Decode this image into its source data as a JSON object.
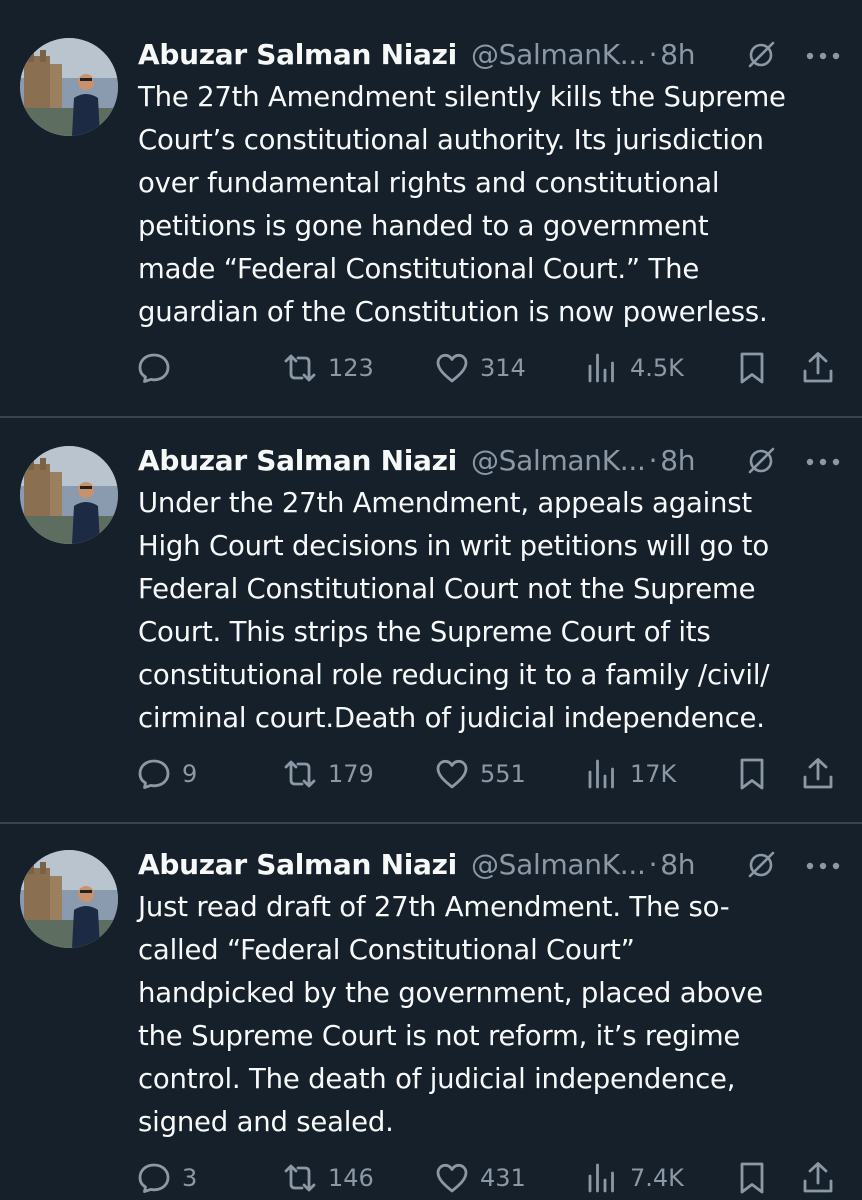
{
  "tweets": [
    {
      "author": {
        "name": "Abuzar Salman Niazi",
        "handle": "@SalmanK...",
        "separator": "·",
        "time": "8h"
      },
      "text": "The 27th Amendment silently kills the Supreme\nCourt’s constitutional authority. Its jurisdiction\nover fundamental rights and constitutional\npetitions is gone  handed to a government\nmade “Federal Constitutional Court.” The\nguardian of the Constitution is now powerless.",
      "stats": {
        "replies": "",
        "retweets": "123",
        "likes": "314",
        "views": "4.5K"
      }
    },
    {
      "author": {
        "name": "Abuzar Salman Niazi",
        "handle": "@SalmanK...",
        "separator": "·",
        "time": "8h"
      },
      "text": "Under the 27th Amendment, appeals against\nHigh Court decisions in writ petitions will go to\nFederal Constitutional Court not the Supreme\nCourt. This strips the Supreme Court of its\nconstitutional role  reducing it to a family /civil/\ncirminal court.Death of judicial independence.",
      "stats": {
        "replies": "9",
        "retweets": "179",
        "likes": "551",
        "views": "17K"
      }
    },
    {
      "author": {
        "name": "Abuzar Salman Niazi",
        "handle": "@SalmanK...",
        "separator": "·",
        "time": "8h"
      },
      "text": "Just read draft of 27th Amendment. The so-\ncalled “Federal Constitutional Court”\nhandpicked by the government, placed above\nthe Supreme Court  is not reform, it’s regime\ncontrol. The death of judicial independence,\nsigned and sealed.",
      "stats": {
        "replies": "3",
        "retweets": "146",
        "likes": "431",
        "views": "7.4K"
      }
    }
  ],
  "icons": {
    "reply": "reply-icon",
    "retweet": "retweet-icon",
    "like": "heart-icon",
    "views": "views-icon",
    "bookmark": "bookmark-icon",
    "share": "share-icon",
    "grok": "grok-icon",
    "more": "more-icon"
  },
  "colors": {
    "background": "#15202b",
    "text": "#f7f9f9",
    "secondary": "#8b98a5",
    "divider": "#38444d"
  }
}
